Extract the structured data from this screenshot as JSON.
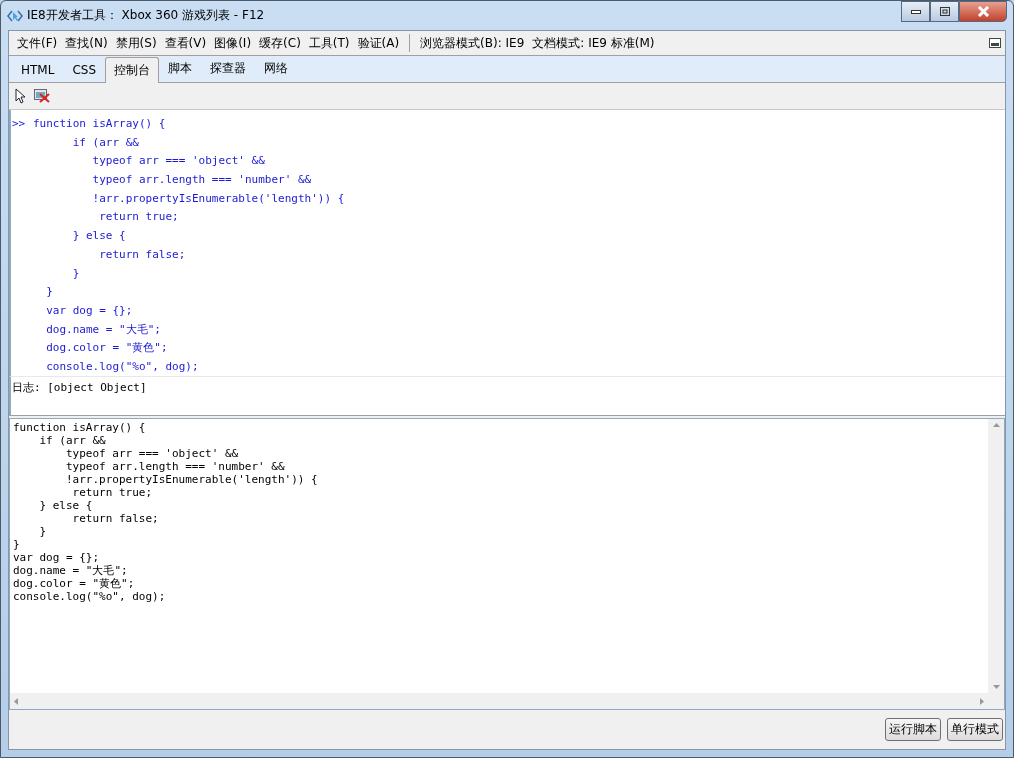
{
  "window": {
    "title": "IE8开发者工具： Xbox 360 游戏列表 - F12"
  },
  "menu": [
    "文件(F)",
    "查找(N)",
    "禁用(S)",
    "查看(V)",
    "图像(I)",
    "缓存(C)",
    "工具(T)",
    "验证(A)"
  ],
  "modes": [
    "浏览器模式(B):  IE9",
    "文档模式:  IE9 标准(M)"
  ],
  "tabs": [
    {
      "label": "HTML",
      "selected": false
    },
    {
      "label": "CSS",
      "selected": false
    },
    {
      "label": "控制台",
      "selected": true
    },
    {
      "label": "脚本",
      "selected": false
    },
    {
      "label": "探查器",
      "selected": false
    },
    {
      "label": "网络",
      "selected": false
    }
  ],
  "console": {
    "prompt": ">>",
    "lines": [
      "function isArray() {",
      "      if (arr &&",
      "         typeof arr === 'object' &&",
      "         typeof arr.length === 'number' &&",
      "         !arr.propertyIsEnumerable('length')) {",
      "          return true;",
      "      } else {",
      "          return false;",
      "      }",
      "  }",
      "  var dog = {};",
      "  dog.name = \"大毛\";",
      "  dog.color = \"黄色\";",
      "  console.log(\"%o\", dog);"
    ],
    "log": "日志: [object Object]"
  },
  "editor": {
    "value": "function isArray() {\n    if (arr &&\n        typeof arr === 'object' &&\n        typeof arr.length === 'number' &&\n        !arr.propertyIsEnumerable('length')) {\n         return true;\n    } else {\n         return false;\n    }\n}\nvar dog = {};\ndog.name = \"大毛\";\ndog.color = \"黄色\";\nconsole.log(\"%o\", dog);"
  },
  "buttons": [
    "运行脚本",
    "单行模式"
  ]
}
